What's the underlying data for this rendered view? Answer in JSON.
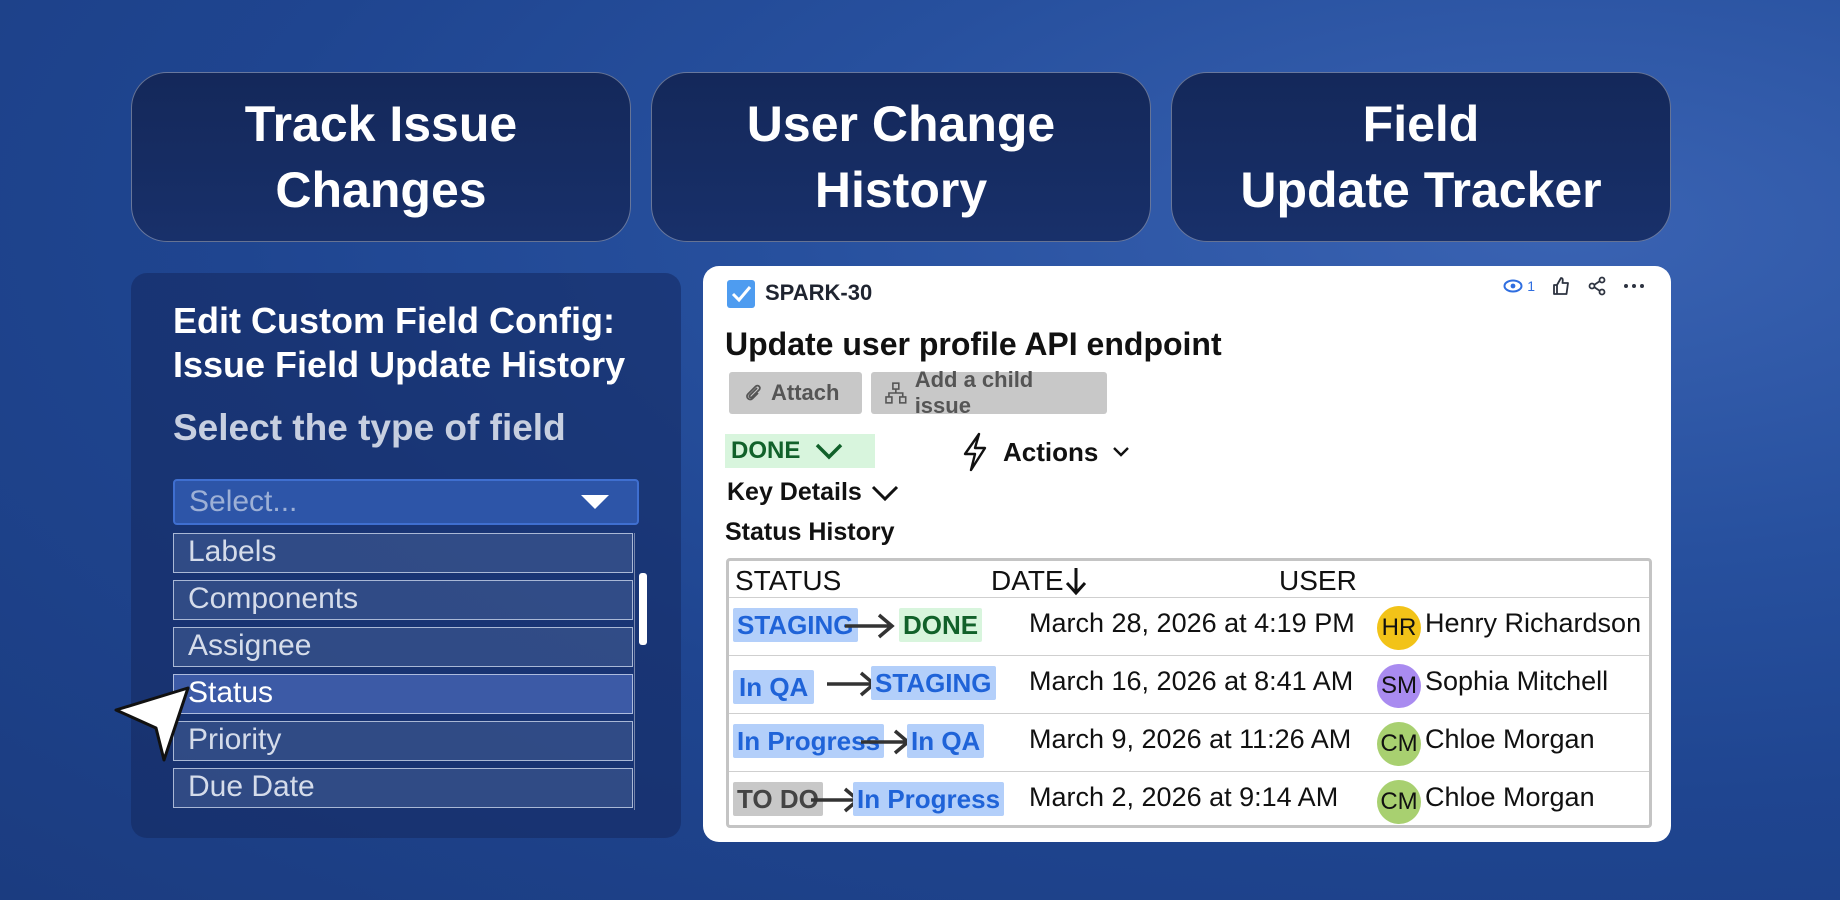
{
  "headers": [
    {
      "text": "Track Issue\nChanges"
    },
    {
      "text": "User Change\nHistory"
    },
    {
      "text": "Field\nUpdate Tracker"
    }
  ],
  "config_panel": {
    "title": "Edit Custom Field Config:\nIssue Field Update History",
    "subtitle": "Select the type of field",
    "select_placeholder": "Select...",
    "options": [
      "Labels",
      "Components",
      "Assignee",
      "Status",
      "Priority",
      "Due Date"
    ],
    "highlighted_option": "Status"
  },
  "issue": {
    "key": "SPARK-30",
    "watchers": "1",
    "title": "Update user profile API endpoint",
    "attach_label": "Attach",
    "child_label": "Add a child issue",
    "status": "DONE",
    "actions_label": "Actions",
    "key_details_label": "Key Details",
    "status_history_label": "Status History"
  },
  "history_table": {
    "columns": [
      "STATUS",
      "DATE",
      "USER"
    ],
    "rows": [
      {
        "from": "STAGING",
        "to": "DONE",
        "date": "March 28, 2026 at 4:19 PM",
        "initials": "HR",
        "user": "Henry Richardson",
        "avatar_color": "#f2c318"
      },
      {
        "from": "In QA",
        "to": "STAGING",
        "date": "March 16, 2026 at 8:41 AM",
        "initials": "SM",
        "user": "Sophia Mitchell",
        "avatar_color": "#a98bf0"
      },
      {
        "from": "In Progress",
        "to": "In QA",
        "date": "March 9, 2026 at 11:26 AM",
        "initials": "CM",
        "user": "Chloe Morgan",
        "avatar_color": "#a8d070"
      },
      {
        "from": "TO DO",
        "to": "In Progress",
        "date": "March 2, 2026 at 9:14 AM",
        "initials": "CM",
        "user": "Chloe Morgan",
        "avatar_color": "#a8d070"
      }
    ]
  },
  "colors": {
    "accent_blue": "#1f63d8",
    "done_green": "#11612a"
  }
}
